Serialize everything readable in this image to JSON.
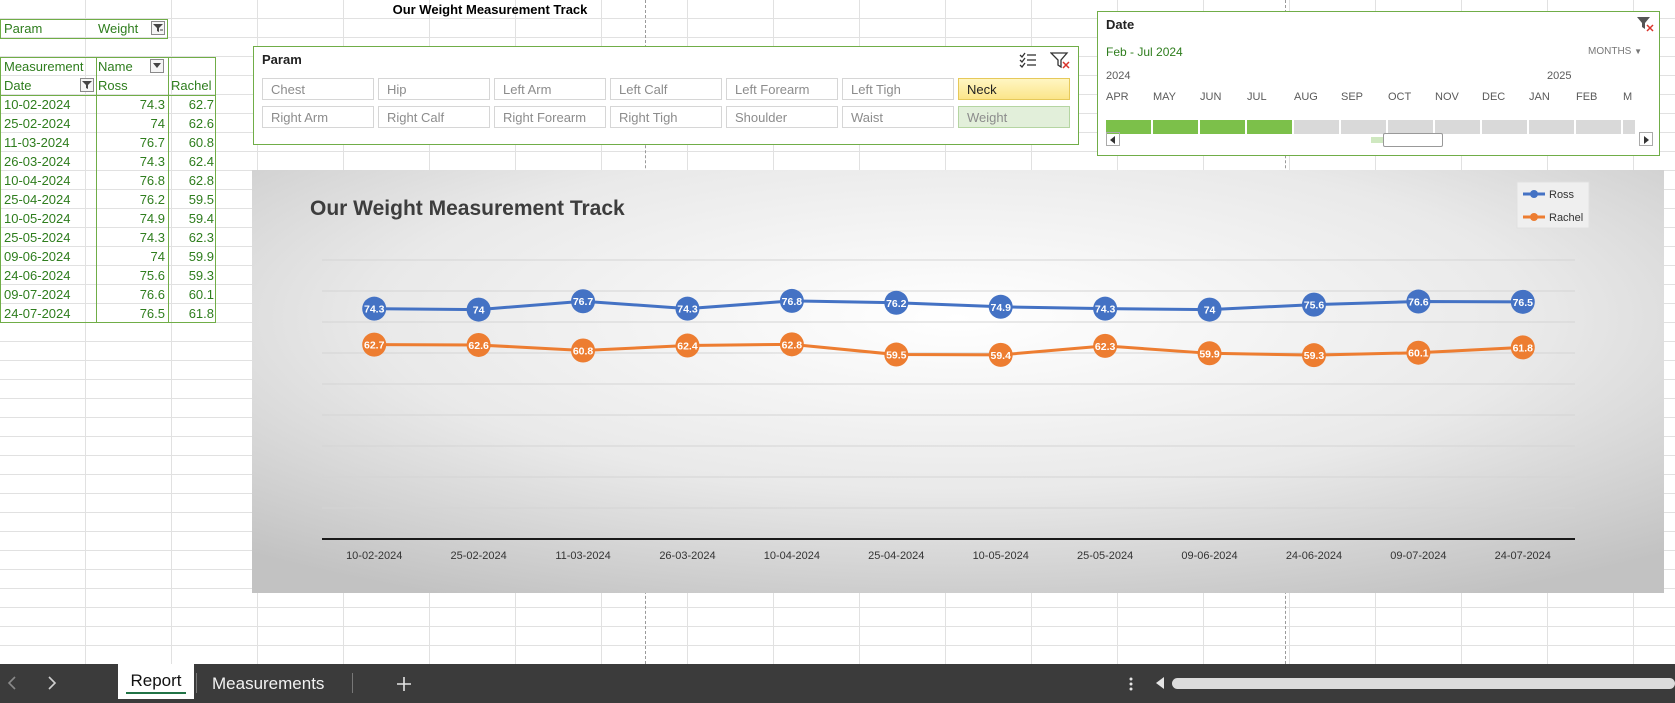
{
  "sheet_title": "Our Weight Measurement Track",
  "pivot": {
    "filter_label": "Param",
    "filter_value": "Weight",
    "values_header": "Measurement",
    "col_field": "Name",
    "row_field": "Date",
    "col1": "Ross",
    "col2": "Rachel",
    "rows": [
      {
        "date": "10-02-2024",
        "ross": "74.3",
        "rachel": "62.7"
      },
      {
        "date": "25-02-2024",
        "ross": "74",
        "rachel": "62.6"
      },
      {
        "date": "11-03-2024",
        "ross": "76.7",
        "rachel": "60.8"
      },
      {
        "date": "26-03-2024",
        "ross": "74.3",
        "rachel": "62.4"
      },
      {
        "date": "10-04-2024",
        "ross": "76.8",
        "rachel": "62.8"
      },
      {
        "date": "25-04-2024",
        "ross": "76.2",
        "rachel": "59.5"
      },
      {
        "date": "10-05-2024",
        "ross": "74.9",
        "rachel": "59.4"
      },
      {
        "date": "25-05-2024",
        "ross": "74.3",
        "rachel": "62.3"
      },
      {
        "date": "09-06-2024",
        "ross": "74",
        "rachel": "59.9"
      },
      {
        "date": "24-06-2024",
        "ross": "75.6",
        "rachel": "59.3"
      },
      {
        "date": "09-07-2024",
        "ross": "76.6",
        "rachel": "60.1"
      },
      {
        "date": "24-07-2024",
        "ross": "76.5",
        "rachel": "61.8"
      }
    ]
  },
  "param_slicer": {
    "title": "Param",
    "items": [
      "Chest",
      "Hip",
      "Left Arm",
      "Left Calf",
      "Left Forearm",
      "Left Tigh",
      "Neck",
      "Right Arm",
      "Right Calf",
      "Right Forearm",
      "Right Tigh",
      "Shoulder",
      "Waist",
      "Weight"
    ],
    "selected": "Weight",
    "highlighted": "Neck",
    "icons": [
      "multi-select-icon",
      "clear-filter-icon"
    ]
  },
  "date_timeline": {
    "title": "Date",
    "range": "Feb - Jul 2024",
    "level": "MONTHS",
    "years": [
      "2024",
      "2025"
    ],
    "months": [
      "APR",
      "MAY",
      "JUN",
      "JUL",
      "AUG",
      "SEP",
      "OCT",
      "NOV",
      "DEC",
      "JAN",
      "FEB",
      "M"
    ],
    "selected_months": 4
  },
  "chart_data": {
    "type": "line",
    "title": "Our Weight Measurement Track",
    "categories": [
      "10-02-2024",
      "25-02-2024",
      "11-03-2024",
      "26-03-2024",
      "10-04-2024",
      "25-04-2024",
      "10-05-2024",
      "25-05-2024",
      "09-06-2024",
      "24-06-2024",
      "09-07-2024",
      "24-07-2024"
    ],
    "series": [
      {
        "name": "Ross",
        "color": "#4472c4",
        "values": [
          74.3,
          74,
          76.7,
          74.3,
          76.8,
          76.2,
          74.9,
          74.3,
          74,
          75.6,
          76.6,
          76.5
        ]
      },
      {
        "name": "Rachel",
        "color": "#ed7d31",
        "values": [
          62.7,
          62.6,
          60.8,
          62.4,
          62.8,
          59.5,
          59.4,
          62.3,
          59.9,
          59.3,
          60.1,
          61.8
        ]
      }
    ],
    "ylim": [
      0,
      90
    ],
    "grid": true,
    "legend": "top-right",
    "data_labels": true
  },
  "sheet_tabs": [
    "Report",
    "Measurements"
  ],
  "active_tab": "Report",
  "icons": {
    "prev_sheet": "chevron-left-icon",
    "next_sheet": "chevron-right-icon",
    "add_sheet": "plus-icon",
    "more": "ellipsis-icon",
    "scroll_left": "scroll-left-icon"
  }
}
